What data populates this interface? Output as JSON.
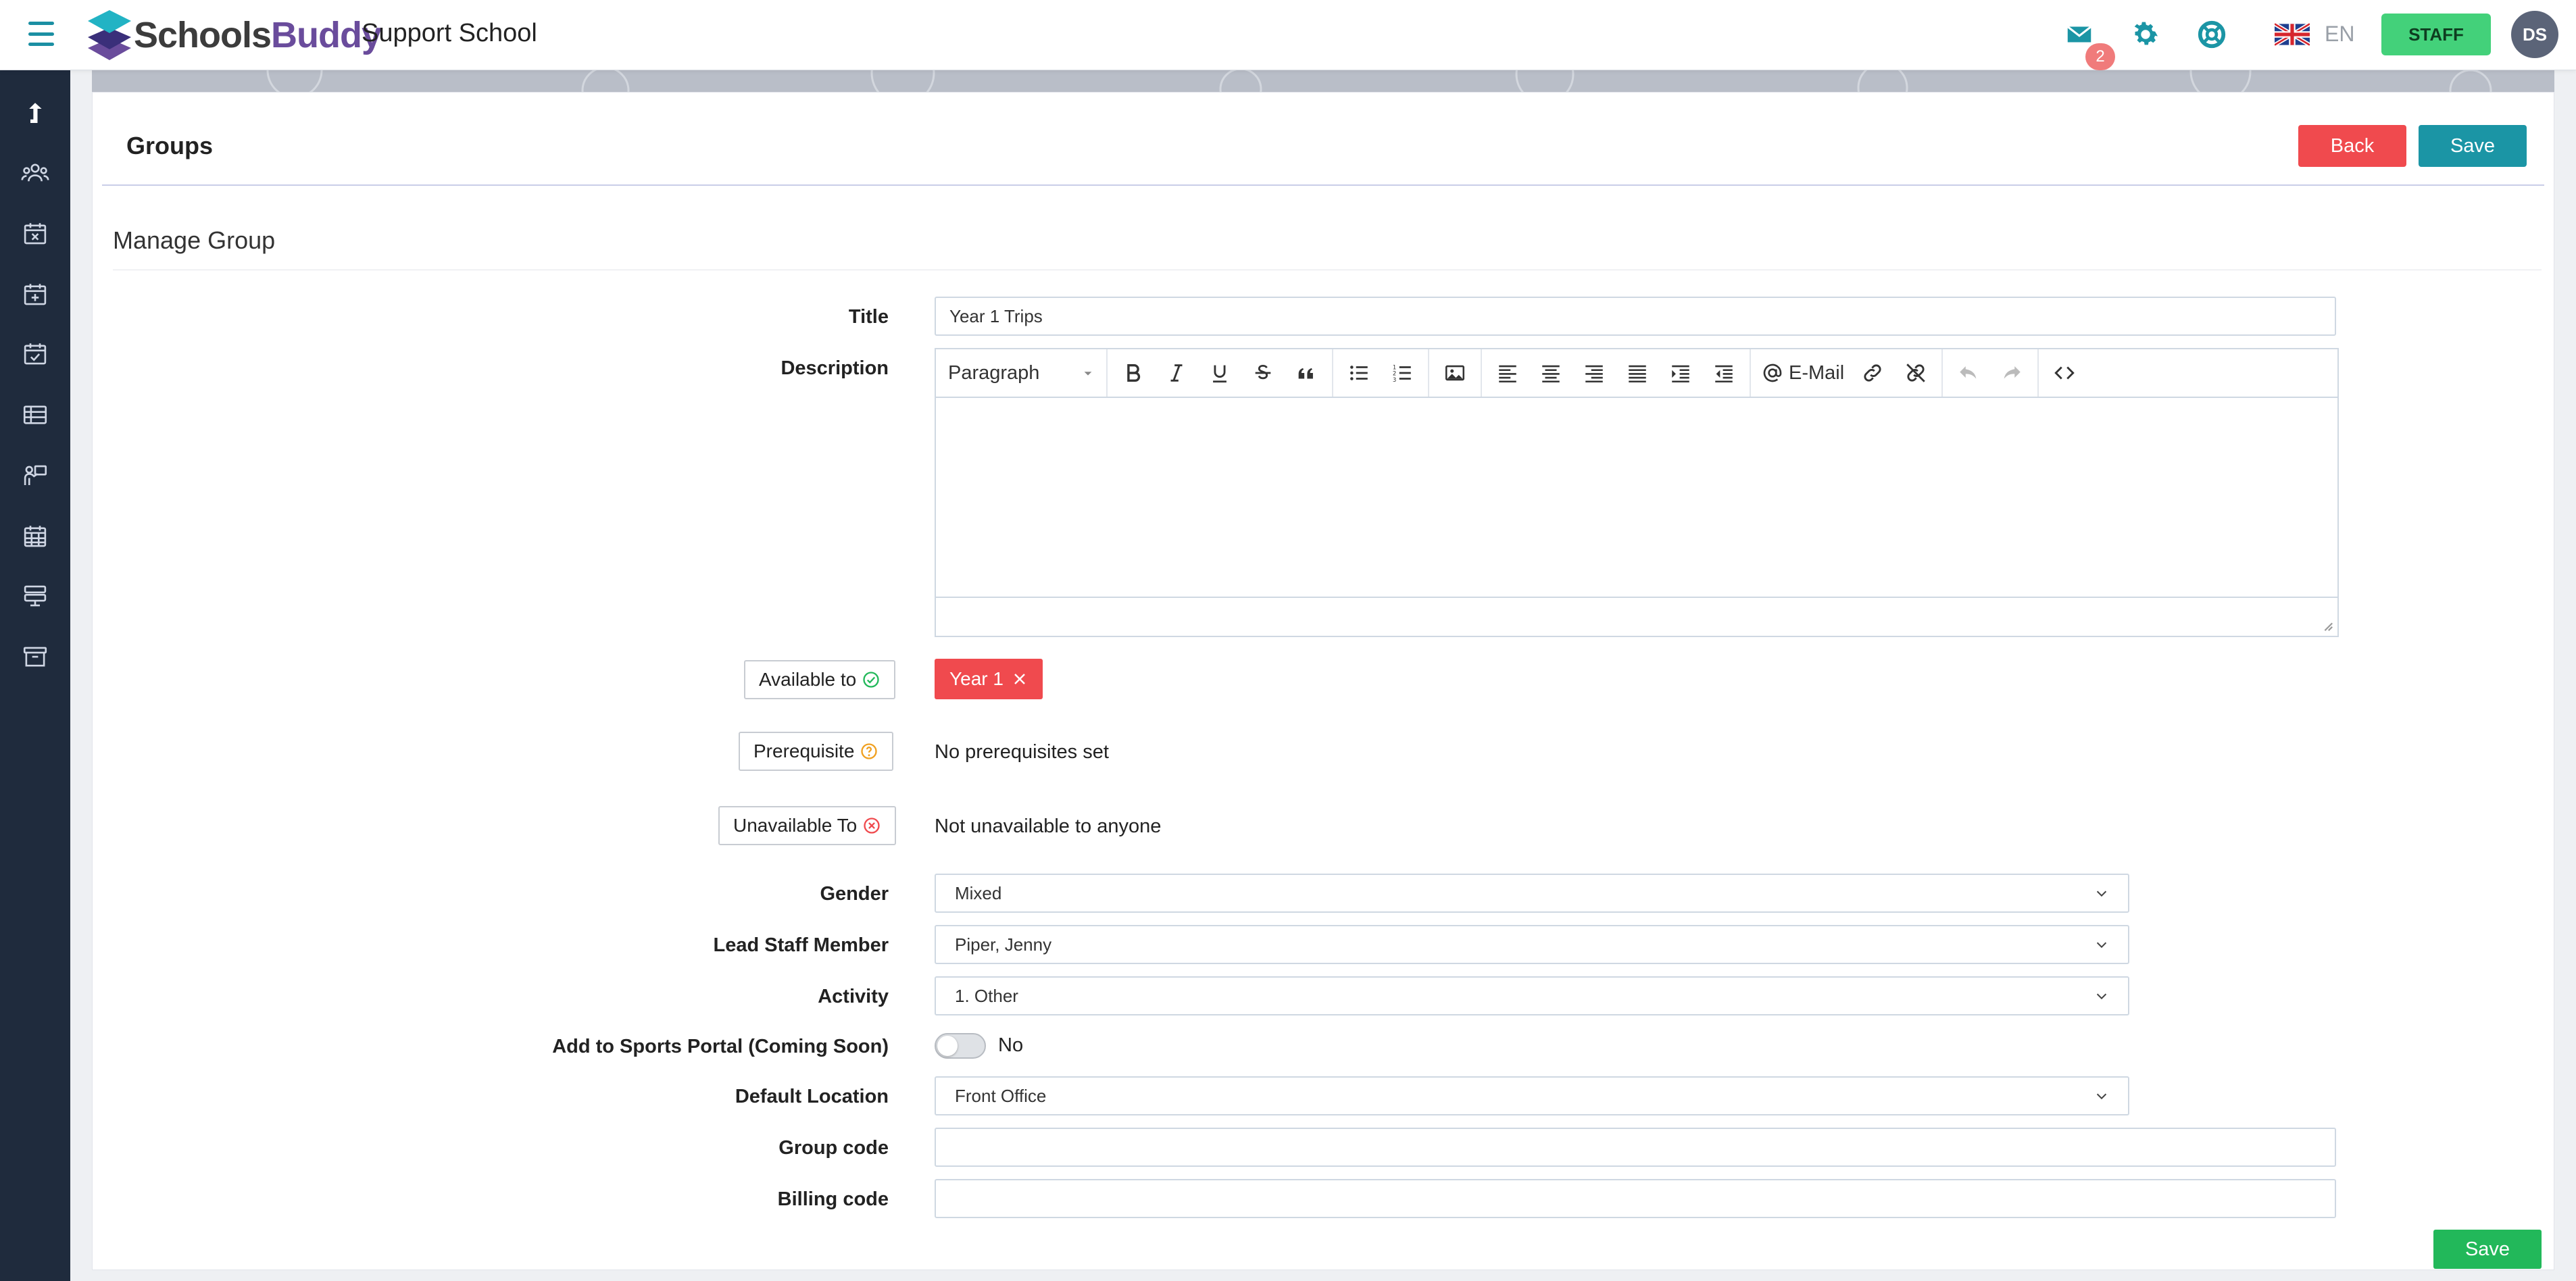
{
  "app": {
    "brand_part1": "Schools",
    "brand_part2": "Buddy",
    "school_name": "Support School",
    "mail_badge": "2",
    "language": "EN",
    "role_button": "STAFF",
    "user_initials": "DS"
  },
  "sidebar": {
    "items": [
      {
        "icon": "upload-arrow-icon"
      },
      {
        "icon": "people-icon"
      },
      {
        "icon": "calendar-x-icon"
      },
      {
        "icon": "calendar-plus-icon"
      },
      {
        "icon": "calendar-check-icon"
      },
      {
        "icon": "table-icon"
      },
      {
        "icon": "person-board-icon"
      },
      {
        "icon": "calendar-grid-icon"
      },
      {
        "icon": "stacked-list-icon"
      },
      {
        "icon": "archive-icon"
      }
    ]
  },
  "header": {
    "title": "Groups",
    "back_label": "Back",
    "save_label": "Save"
  },
  "form": {
    "section_title": "Manage Group",
    "title_label": "Title",
    "title_value": "Year 1 Trips",
    "description_label": "Description",
    "editor": {
      "block_format": "Paragraph",
      "email_label": "E-Mail"
    },
    "available_to_label": "Available to",
    "available_to_tag": "Year 1",
    "prerequisite_label": "Prerequisite",
    "prerequisite_value": "No prerequisites set",
    "unavailable_to_label": "Unavailable To",
    "unavailable_to_value": "Not unavailable to anyone",
    "gender_label": "Gender",
    "gender_value": "Mixed",
    "lead_staff_label": "Lead Staff Member",
    "lead_staff_value": "Piper, Jenny",
    "activity_label": "Activity",
    "activity_value": "1. Other",
    "sports_portal_label": "Add to Sports Portal (Coming Soon)",
    "sports_portal_value": "No",
    "default_location_label": "Default Location",
    "default_location_value": "Front Office",
    "group_code_label": "Group code",
    "group_code_value": "",
    "billing_code_label": "Billing code",
    "billing_code_value": "",
    "save_label": "Save"
  },
  "colors": {
    "accent": "#1b95a5",
    "danger": "#f04a4e",
    "success": "#22b85a",
    "staff": "#43d17a",
    "sidebar": "#1f2b3d",
    "brand_purple": "#6a4c9c"
  }
}
